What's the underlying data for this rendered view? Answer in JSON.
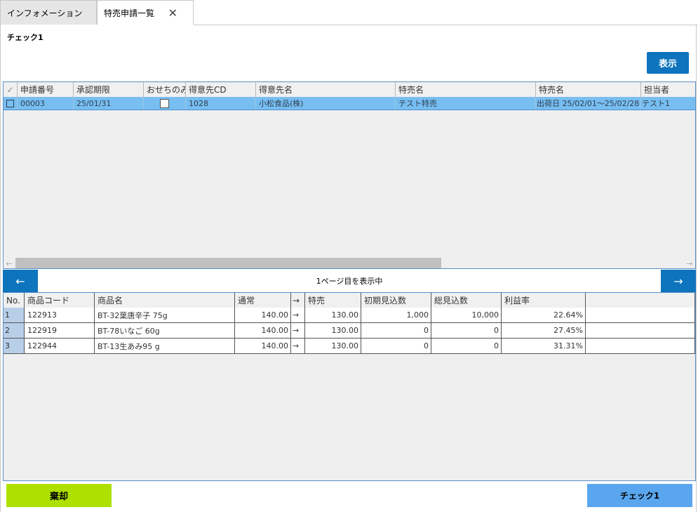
{
  "tabs": [
    {
      "label": "インフォメーション"
    },
    {
      "label": "特売申請一覧",
      "close": "✕"
    }
  ],
  "section_title": "チェック1",
  "show_button": "表示",
  "grid1": {
    "check_header": "✓",
    "headers": [
      "申請番号",
      "承認期限",
      "おせちのみ",
      "得意先CD",
      "得意先名",
      "特売名",
      "特売名",
      "担当者"
    ],
    "rows": [
      {
        "no": "00003",
        "deadline": "25/01/31",
        "osechi": false,
        "cust_cd": "1028",
        "cust_name": "小松食品(株)",
        "sale_name": "テスト特売",
        "sale_period": "出荷日 25/02/01～25/02/28",
        "staff": "テスト1"
      }
    ]
  },
  "pager": {
    "prev": "←",
    "next": "→",
    "label": "1ページ目を表示中"
  },
  "grid2": {
    "headers": [
      "No.",
      "商品コード",
      "商品名",
      "通常",
      "→",
      "特売",
      "初期見込数",
      "総見込数",
      "利益率"
    ],
    "rows": [
      {
        "no": "1",
        "code": "122913",
        "name": "BT-32葉唐辛子 75g",
        "normal": "140.00",
        "arrow": "→",
        "sale": "130.00",
        "initial": "1,000",
        "total": "10,000",
        "margin": "22.64%"
      },
      {
        "no": "2",
        "code": "122919",
        "name": "BT-78いなご 60g",
        "normal": "140.00",
        "arrow": "→",
        "sale": "130.00",
        "initial": "0",
        "total": "0",
        "margin": "27.45%"
      },
      {
        "no": "3",
        "code": "122944",
        "name": "BT-13生あみ95 g",
        "normal": "140.00",
        "arrow": "→",
        "sale": "130.00",
        "initial": "0",
        "total": "0",
        "margin": "31.31%"
      }
    ]
  },
  "footer": {
    "reject": "棄却",
    "check": "チェック1"
  }
}
